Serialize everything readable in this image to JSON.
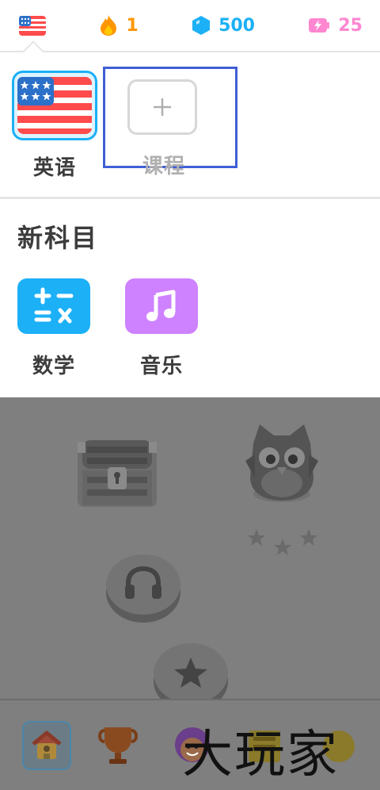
{
  "topbar": {
    "flag_icon": "us-flag-icon",
    "streak": "1",
    "gems": "500",
    "energy": "25",
    "colors": {
      "streak": "#ff9600",
      "gems": "#1cb0f6",
      "energy": "#ff86d0"
    }
  },
  "courses": {
    "items": [
      {
        "label": "英语",
        "icon": "us-flag-icon",
        "selected": true
      }
    ],
    "add": {
      "label": "课程",
      "icon": "plus-icon"
    }
  },
  "subjects": {
    "title": "新科目",
    "items": [
      {
        "label": "数学",
        "icon": "math-icon",
        "color": "#1cb0f6"
      },
      {
        "label": "音乐",
        "icon": "music-icon",
        "color": "#ce82ff"
      }
    ]
  },
  "path": {
    "nodes": [
      "treasure-chest-icon",
      "owl-character-icon",
      "headphones-icon",
      "star-icon"
    ]
  },
  "bottom_nav": {
    "items": [
      "home-icon",
      "trophy-icon",
      "avatar-icon",
      "quest-icon",
      "shop-icon"
    ]
  },
  "watermark": "大玩家"
}
